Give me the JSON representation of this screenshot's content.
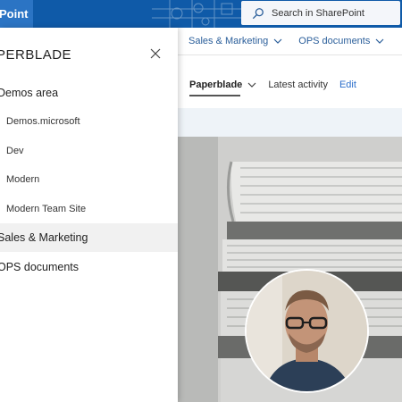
{
  "suitebar": {
    "app_name": "Point",
    "search_placeholder": "Search in SharePoint",
    "color": "#0f5aa8"
  },
  "hubnav": {
    "items": [
      {
        "label": "Sales & Marketing"
      },
      {
        "label": "OPS documents"
      }
    ]
  },
  "sitenav": {
    "items": [
      {
        "label": "Paperblade"
      },
      {
        "label": "Latest activity"
      },
      {
        "label": "Edit"
      }
    ]
  },
  "panel": {
    "title": "PERBLADE",
    "items": [
      {
        "label": "Demos area",
        "level": "top"
      },
      {
        "label": "Demos.microsoft",
        "level": "sub"
      },
      {
        "label": "Dev",
        "level": "sub"
      },
      {
        "label": "Modern",
        "level": "sub"
      },
      {
        "label": "Modern Team Site",
        "level": "sub"
      },
      {
        "label": "Sales & Marketing",
        "level": "top",
        "selected": true
      },
      {
        "label": "OPS documents",
        "level": "top"
      }
    ]
  },
  "icons": {
    "search": "search-icon",
    "close": "close-icon",
    "chevron": "chevron-down-icon"
  }
}
